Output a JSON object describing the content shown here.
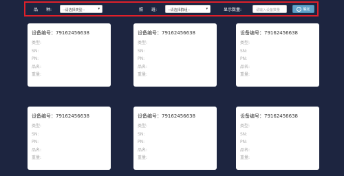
{
  "toolbar": {
    "variety_label": "品　　种:",
    "variety_select": "--请选择类型--",
    "rank_label": "照　　班:",
    "rank_select": "--请选择群组--",
    "count_label": "显示数量:",
    "count_placeholder": "请输入设备数量",
    "confirm_label": "确定"
  },
  "cards": [
    {
      "title": "设备编号：79162456638",
      "fields": [
        "类型:",
        "SN:",
        "PN:",
        "品名:",
        "重量:"
      ]
    },
    {
      "title": "设备编号：79162456638",
      "fields": [
        "类型:",
        "SN:",
        "PN:",
        "品名:",
        "重量:"
      ]
    },
    {
      "title": "设备编号：79162456638",
      "fields": [
        "类型:",
        "SN:",
        "PN:",
        "品名:",
        "重量:"
      ]
    },
    {
      "title": "设备编号：79162456638",
      "fields": [
        "类型:",
        "SN:",
        "PN:",
        "品名:",
        "重量:"
      ]
    },
    {
      "title": "设备编号：79162456638",
      "fields": [
        "类型:",
        "SN:",
        "PN:",
        "品名:",
        "重量:"
      ]
    },
    {
      "title": "设备编号：79162456638",
      "fields": [
        "类型:",
        "SN:",
        "PN:",
        "品名:",
        "重量:"
      ]
    }
  ],
  "colors": {
    "background": "#1d2540",
    "toolbar_border": "#e0202a",
    "button": "#5fa3c9"
  }
}
